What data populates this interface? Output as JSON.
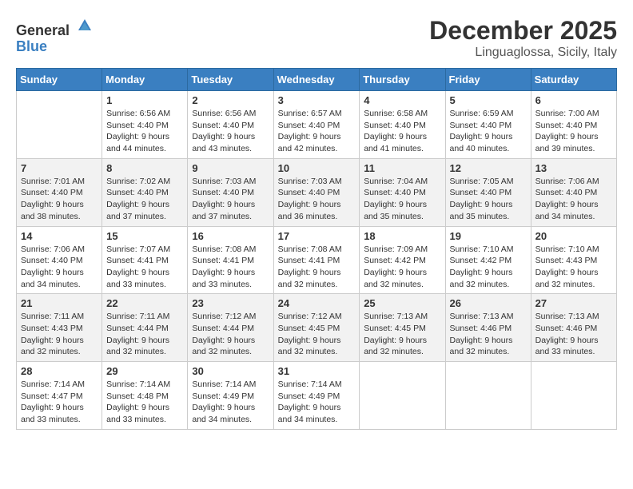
{
  "header": {
    "logo_general": "General",
    "logo_blue": "Blue",
    "month": "December 2025",
    "location": "Linguaglossa, Sicily, Italy"
  },
  "weekdays": [
    "Sunday",
    "Monday",
    "Tuesday",
    "Wednesday",
    "Thursday",
    "Friday",
    "Saturday"
  ],
  "weeks": [
    [
      {
        "day": "",
        "sunrise": "",
        "sunset": "",
        "daylight": ""
      },
      {
        "day": "1",
        "sunrise": "Sunrise: 6:56 AM",
        "sunset": "Sunset: 4:40 PM",
        "daylight": "Daylight: 9 hours and 44 minutes."
      },
      {
        "day": "2",
        "sunrise": "Sunrise: 6:56 AM",
        "sunset": "Sunset: 4:40 PM",
        "daylight": "Daylight: 9 hours and 43 minutes."
      },
      {
        "day": "3",
        "sunrise": "Sunrise: 6:57 AM",
        "sunset": "Sunset: 4:40 PM",
        "daylight": "Daylight: 9 hours and 42 minutes."
      },
      {
        "day": "4",
        "sunrise": "Sunrise: 6:58 AM",
        "sunset": "Sunset: 4:40 PM",
        "daylight": "Daylight: 9 hours and 41 minutes."
      },
      {
        "day": "5",
        "sunrise": "Sunrise: 6:59 AM",
        "sunset": "Sunset: 4:40 PM",
        "daylight": "Daylight: 9 hours and 40 minutes."
      },
      {
        "day": "6",
        "sunrise": "Sunrise: 7:00 AM",
        "sunset": "Sunset: 4:40 PM",
        "daylight": "Daylight: 9 hours and 39 minutes."
      }
    ],
    [
      {
        "day": "7",
        "sunrise": "Sunrise: 7:01 AM",
        "sunset": "Sunset: 4:40 PM",
        "daylight": "Daylight: 9 hours and 38 minutes."
      },
      {
        "day": "8",
        "sunrise": "Sunrise: 7:02 AM",
        "sunset": "Sunset: 4:40 PM",
        "daylight": "Daylight: 9 hours and 37 minutes."
      },
      {
        "day": "9",
        "sunrise": "Sunrise: 7:03 AM",
        "sunset": "Sunset: 4:40 PM",
        "daylight": "Daylight: 9 hours and 37 minutes."
      },
      {
        "day": "10",
        "sunrise": "Sunrise: 7:03 AM",
        "sunset": "Sunset: 4:40 PM",
        "daylight": "Daylight: 9 hours and 36 minutes."
      },
      {
        "day": "11",
        "sunrise": "Sunrise: 7:04 AM",
        "sunset": "Sunset: 4:40 PM",
        "daylight": "Daylight: 9 hours and 35 minutes."
      },
      {
        "day": "12",
        "sunrise": "Sunrise: 7:05 AM",
        "sunset": "Sunset: 4:40 PM",
        "daylight": "Daylight: 9 hours and 35 minutes."
      },
      {
        "day": "13",
        "sunrise": "Sunrise: 7:06 AM",
        "sunset": "Sunset: 4:40 PM",
        "daylight": "Daylight: 9 hours and 34 minutes."
      }
    ],
    [
      {
        "day": "14",
        "sunrise": "Sunrise: 7:06 AM",
        "sunset": "Sunset: 4:40 PM",
        "daylight": "Daylight: 9 hours and 34 minutes."
      },
      {
        "day": "15",
        "sunrise": "Sunrise: 7:07 AM",
        "sunset": "Sunset: 4:41 PM",
        "daylight": "Daylight: 9 hours and 33 minutes."
      },
      {
        "day": "16",
        "sunrise": "Sunrise: 7:08 AM",
        "sunset": "Sunset: 4:41 PM",
        "daylight": "Daylight: 9 hours and 33 minutes."
      },
      {
        "day": "17",
        "sunrise": "Sunrise: 7:08 AM",
        "sunset": "Sunset: 4:41 PM",
        "daylight": "Daylight: 9 hours and 32 minutes."
      },
      {
        "day": "18",
        "sunrise": "Sunrise: 7:09 AM",
        "sunset": "Sunset: 4:42 PM",
        "daylight": "Daylight: 9 hours and 32 minutes."
      },
      {
        "day": "19",
        "sunrise": "Sunrise: 7:10 AM",
        "sunset": "Sunset: 4:42 PM",
        "daylight": "Daylight: 9 hours and 32 minutes."
      },
      {
        "day": "20",
        "sunrise": "Sunrise: 7:10 AM",
        "sunset": "Sunset: 4:43 PM",
        "daylight": "Daylight: 9 hours and 32 minutes."
      }
    ],
    [
      {
        "day": "21",
        "sunrise": "Sunrise: 7:11 AM",
        "sunset": "Sunset: 4:43 PM",
        "daylight": "Daylight: 9 hours and 32 minutes."
      },
      {
        "day": "22",
        "sunrise": "Sunrise: 7:11 AM",
        "sunset": "Sunset: 4:44 PM",
        "daylight": "Daylight: 9 hours and 32 minutes."
      },
      {
        "day": "23",
        "sunrise": "Sunrise: 7:12 AM",
        "sunset": "Sunset: 4:44 PM",
        "daylight": "Daylight: 9 hours and 32 minutes."
      },
      {
        "day": "24",
        "sunrise": "Sunrise: 7:12 AM",
        "sunset": "Sunset: 4:45 PM",
        "daylight": "Daylight: 9 hours and 32 minutes."
      },
      {
        "day": "25",
        "sunrise": "Sunrise: 7:13 AM",
        "sunset": "Sunset: 4:45 PM",
        "daylight": "Daylight: 9 hours and 32 minutes."
      },
      {
        "day": "26",
        "sunrise": "Sunrise: 7:13 AM",
        "sunset": "Sunset: 4:46 PM",
        "daylight": "Daylight: 9 hours and 32 minutes."
      },
      {
        "day": "27",
        "sunrise": "Sunrise: 7:13 AM",
        "sunset": "Sunset: 4:46 PM",
        "daylight": "Daylight: 9 hours and 33 minutes."
      }
    ],
    [
      {
        "day": "28",
        "sunrise": "Sunrise: 7:14 AM",
        "sunset": "Sunset: 4:47 PM",
        "daylight": "Daylight: 9 hours and 33 minutes."
      },
      {
        "day": "29",
        "sunrise": "Sunrise: 7:14 AM",
        "sunset": "Sunset: 4:48 PM",
        "daylight": "Daylight: 9 hours and 33 minutes."
      },
      {
        "day": "30",
        "sunrise": "Sunrise: 7:14 AM",
        "sunset": "Sunset: 4:49 PM",
        "daylight": "Daylight: 9 hours and 34 minutes."
      },
      {
        "day": "31",
        "sunrise": "Sunrise: 7:14 AM",
        "sunset": "Sunset: 4:49 PM",
        "daylight": "Daylight: 9 hours and 34 minutes."
      },
      {
        "day": "",
        "sunrise": "",
        "sunset": "",
        "daylight": ""
      },
      {
        "day": "",
        "sunrise": "",
        "sunset": "",
        "daylight": ""
      },
      {
        "day": "",
        "sunrise": "",
        "sunset": "",
        "daylight": ""
      }
    ]
  ]
}
